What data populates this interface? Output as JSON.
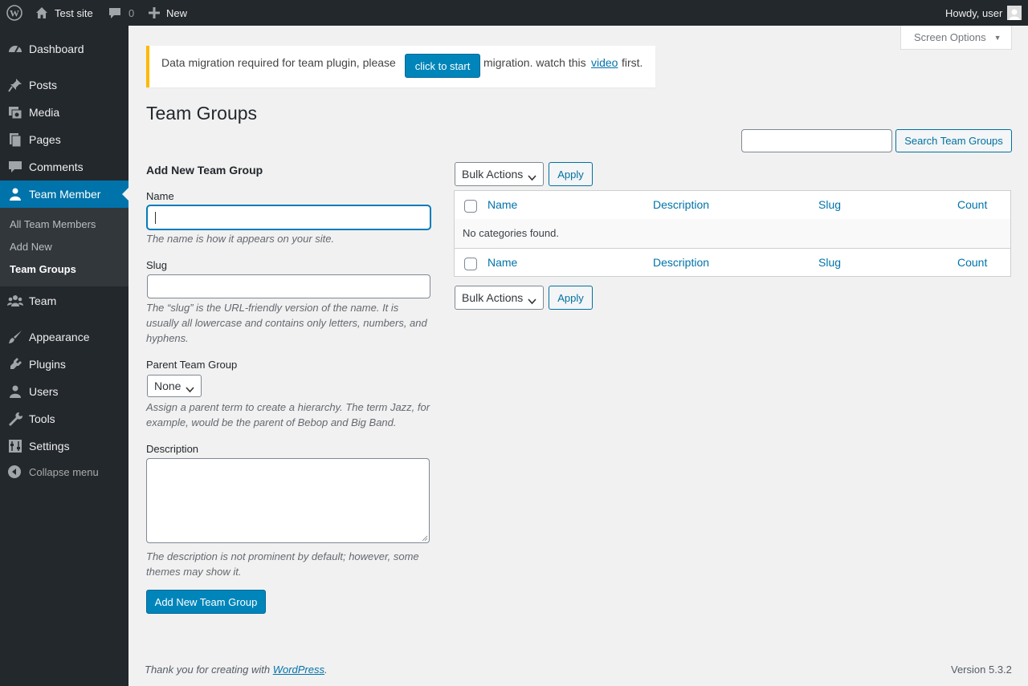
{
  "adminbar": {
    "site_name": "Test site",
    "comments_count": "0",
    "new_label": "New",
    "howdy": "Howdy, user"
  },
  "sidebar": {
    "items": [
      {
        "label": "Dashboard",
        "icon": "dashboard-icon"
      },
      {
        "label": "Posts",
        "icon": "pin-icon"
      },
      {
        "label": "Media",
        "icon": "media-icon"
      },
      {
        "label": "Pages",
        "icon": "pages-icon"
      },
      {
        "label": "Comments",
        "icon": "comment-icon"
      },
      {
        "label": "Team Member",
        "icon": "person-icon"
      },
      {
        "label": "Team",
        "icon": "groups-icon"
      },
      {
        "label": "Appearance",
        "icon": "brush-icon"
      },
      {
        "label": "Plugins",
        "icon": "plug-icon"
      },
      {
        "label": "Users",
        "icon": "user-icon"
      },
      {
        "label": "Tools",
        "icon": "wrench-icon"
      },
      {
        "label": "Settings",
        "icon": "settings-icon"
      }
    ],
    "submenu": [
      "All Team Members",
      "Add New",
      "Team Groups"
    ],
    "collapse_label": "Collapse menu"
  },
  "screen_options": "Screen Options",
  "notice": {
    "text_before": "Data migration required for team plugin, please",
    "button": "click to start",
    "text_middle": "migration. watch this",
    "link": "video",
    "text_after": "first."
  },
  "page_title": "Team Groups",
  "search": {
    "button": "Search Team Groups",
    "value": ""
  },
  "form": {
    "title": "Add New Team Group",
    "name_label": "Name",
    "name_help": "The name is how it appears on your site.",
    "slug_label": "Slug",
    "slug_help": "The “slug” is the URL-friendly version of the name. It is usually all lowercase and contains only letters, numbers, and hyphens.",
    "parent_label": "Parent Team Group",
    "parent_value": "None",
    "parent_help": "Assign a parent term to create a hierarchy. The term Jazz, for example, would be the parent of Bebop and Big Band.",
    "description_label": "Description",
    "description_help": "The description is not prominent by default; however, some themes may show it.",
    "submit": "Add New Team Group"
  },
  "table": {
    "bulk_actions": "Bulk Actions",
    "apply": "Apply",
    "columns": [
      "Name",
      "Description",
      "Slug",
      "Count"
    ],
    "empty": "No categories found."
  },
  "footer": {
    "thanks_before": "Thank you for creating with",
    "thanks_link": "WordPress",
    "thanks_after": ".",
    "version": "Version 5.3.2"
  },
  "colors": {
    "accent": "#0073aa",
    "adminbar": "#23282d",
    "notice_warning": "#ffb900"
  }
}
